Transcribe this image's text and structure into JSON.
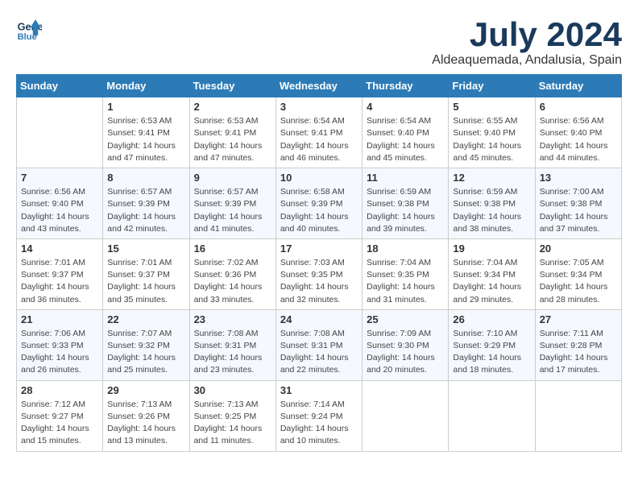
{
  "header": {
    "logo_line1": "General",
    "logo_line2": "Blue",
    "month": "July 2024",
    "location": "Aldeaquemada, Andalusia, Spain"
  },
  "days_of_week": [
    "Sunday",
    "Monday",
    "Tuesday",
    "Wednesday",
    "Thursday",
    "Friday",
    "Saturday"
  ],
  "weeks": [
    [
      {
        "day": "",
        "sunrise": "",
        "sunset": "",
        "daylight": ""
      },
      {
        "day": "1",
        "sunrise": "Sunrise: 6:53 AM",
        "sunset": "Sunset: 9:41 PM",
        "daylight": "Daylight: 14 hours and 47 minutes."
      },
      {
        "day": "2",
        "sunrise": "Sunrise: 6:53 AM",
        "sunset": "Sunset: 9:41 PM",
        "daylight": "Daylight: 14 hours and 47 minutes."
      },
      {
        "day": "3",
        "sunrise": "Sunrise: 6:54 AM",
        "sunset": "Sunset: 9:41 PM",
        "daylight": "Daylight: 14 hours and 46 minutes."
      },
      {
        "day": "4",
        "sunrise": "Sunrise: 6:54 AM",
        "sunset": "Sunset: 9:40 PM",
        "daylight": "Daylight: 14 hours and 45 minutes."
      },
      {
        "day": "5",
        "sunrise": "Sunrise: 6:55 AM",
        "sunset": "Sunset: 9:40 PM",
        "daylight": "Daylight: 14 hours and 45 minutes."
      },
      {
        "day": "6",
        "sunrise": "Sunrise: 6:56 AM",
        "sunset": "Sunset: 9:40 PM",
        "daylight": "Daylight: 14 hours and 44 minutes."
      }
    ],
    [
      {
        "day": "7",
        "sunrise": "Sunrise: 6:56 AM",
        "sunset": "Sunset: 9:40 PM",
        "daylight": "Daylight: 14 hours and 43 minutes."
      },
      {
        "day": "8",
        "sunrise": "Sunrise: 6:57 AM",
        "sunset": "Sunset: 9:39 PM",
        "daylight": "Daylight: 14 hours and 42 minutes."
      },
      {
        "day": "9",
        "sunrise": "Sunrise: 6:57 AM",
        "sunset": "Sunset: 9:39 PM",
        "daylight": "Daylight: 14 hours and 41 minutes."
      },
      {
        "day": "10",
        "sunrise": "Sunrise: 6:58 AM",
        "sunset": "Sunset: 9:39 PM",
        "daylight": "Daylight: 14 hours and 40 minutes."
      },
      {
        "day": "11",
        "sunrise": "Sunrise: 6:59 AM",
        "sunset": "Sunset: 9:38 PM",
        "daylight": "Daylight: 14 hours and 39 minutes."
      },
      {
        "day": "12",
        "sunrise": "Sunrise: 6:59 AM",
        "sunset": "Sunset: 9:38 PM",
        "daylight": "Daylight: 14 hours and 38 minutes."
      },
      {
        "day": "13",
        "sunrise": "Sunrise: 7:00 AM",
        "sunset": "Sunset: 9:38 PM",
        "daylight": "Daylight: 14 hours and 37 minutes."
      }
    ],
    [
      {
        "day": "14",
        "sunrise": "Sunrise: 7:01 AM",
        "sunset": "Sunset: 9:37 PM",
        "daylight": "Daylight: 14 hours and 36 minutes."
      },
      {
        "day": "15",
        "sunrise": "Sunrise: 7:01 AM",
        "sunset": "Sunset: 9:37 PM",
        "daylight": "Daylight: 14 hours and 35 minutes."
      },
      {
        "day": "16",
        "sunrise": "Sunrise: 7:02 AM",
        "sunset": "Sunset: 9:36 PM",
        "daylight": "Daylight: 14 hours and 33 minutes."
      },
      {
        "day": "17",
        "sunrise": "Sunrise: 7:03 AM",
        "sunset": "Sunset: 9:35 PM",
        "daylight": "Daylight: 14 hours and 32 minutes."
      },
      {
        "day": "18",
        "sunrise": "Sunrise: 7:04 AM",
        "sunset": "Sunset: 9:35 PM",
        "daylight": "Daylight: 14 hours and 31 minutes."
      },
      {
        "day": "19",
        "sunrise": "Sunrise: 7:04 AM",
        "sunset": "Sunset: 9:34 PM",
        "daylight": "Daylight: 14 hours and 29 minutes."
      },
      {
        "day": "20",
        "sunrise": "Sunrise: 7:05 AM",
        "sunset": "Sunset: 9:34 PM",
        "daylight": "Daylight: 14 hours and 28 minutes."
      }
    ],
    [
      {
        "day": "21",
        "sunrise": "Sunrise: 7:06 AM",
        "sunset": "Sunset: 9:33 PM",
        "daylight": "Daylight: 14 hours and 26 minutes."
      },
      {
        "day": "22",
        "sunrise": "Sunrise: 7:07 AM",
        "sunset": "Sunset: 9:32 PM",
        "daylight": "Daylight: 14 hours and 25 minutes."
      },
      {
        "day": "23",
        "sunrise": "Sunrise: 7:08 AM",
        "sunset": "Sunset: 9:31 PM",
        "daylight": "Daylight: 14 hours and 23 minutes."
      },
      {
        "day": "24",
        "sunrise": "Sunrise: 7:08 AM",
        "sunset": "Sunset: 9:31 PM",
        "daylight": "Daylight: 14 hours and 22 minutes."
      },
      {
        "day": "25",
        "sunrise": "Sunrise: 7:09 AM",
        "sunset": "Sunset: 9:30 PM",
        "daylight": "Daylight: 14 hours and 20 minutes."
      },
      {
        "day": "26",
        "sunrise": "Sunrise: 7:10 AM",
        "sunset": "Sunset: 9:29 PM",
        "daylight": "Daylight: 14 hours and 18 minutes."
      },
      {
        "day": "27",
        "sunrise": "Sunrise: 7:11 AM",
        "sunset": "Sunset: 9:28 PM",
        "daylight": "Daylight: 14 hours and 17 minutes."
      }
    ],
    [
      {
        "day": "28",
        "sunrise": "Sunrise: 7:12 AM",
        "sunset": "Sunset: 9:27 PM",
        "daylight": "Daylight: 14 hours and 15 minutes."
      },
      {
        "day": "29",
        "sunrise": "Sunrise: 7:13 AM",
        "sunset": "Sunset: 9:26 PM",
        "daylight": "Daylight: 14 hours and 13 minutes."
      },
      {
        "day": "30",
        "sunrise": "Sunrise: 7:13 AM",
        "sunset": "Sunset: 9:25 PM",
        "daylight": "Daylight: 14 hours and 11 minutes."
      },
      {
        "day": "31",
        "sunrise": "Sunrise: 7:14 AM",
        "sunset": "Sunset: 9:24 PM",
        "daylight": "Daylight: 14 hours and 10 minutes."
      },
      {
        "day": "",
        "sunrise": "",
        "sunset": "",
        "daylight": ""
      },
      {
        "day": "",
        "sunrise": "",
        "sunset": "",
        "daylight": ""
      },
      {
        "day": "",
        "sunrise": "",
        "sunset": "",
        "daylight": ""
      }
    ]
  ]
}
